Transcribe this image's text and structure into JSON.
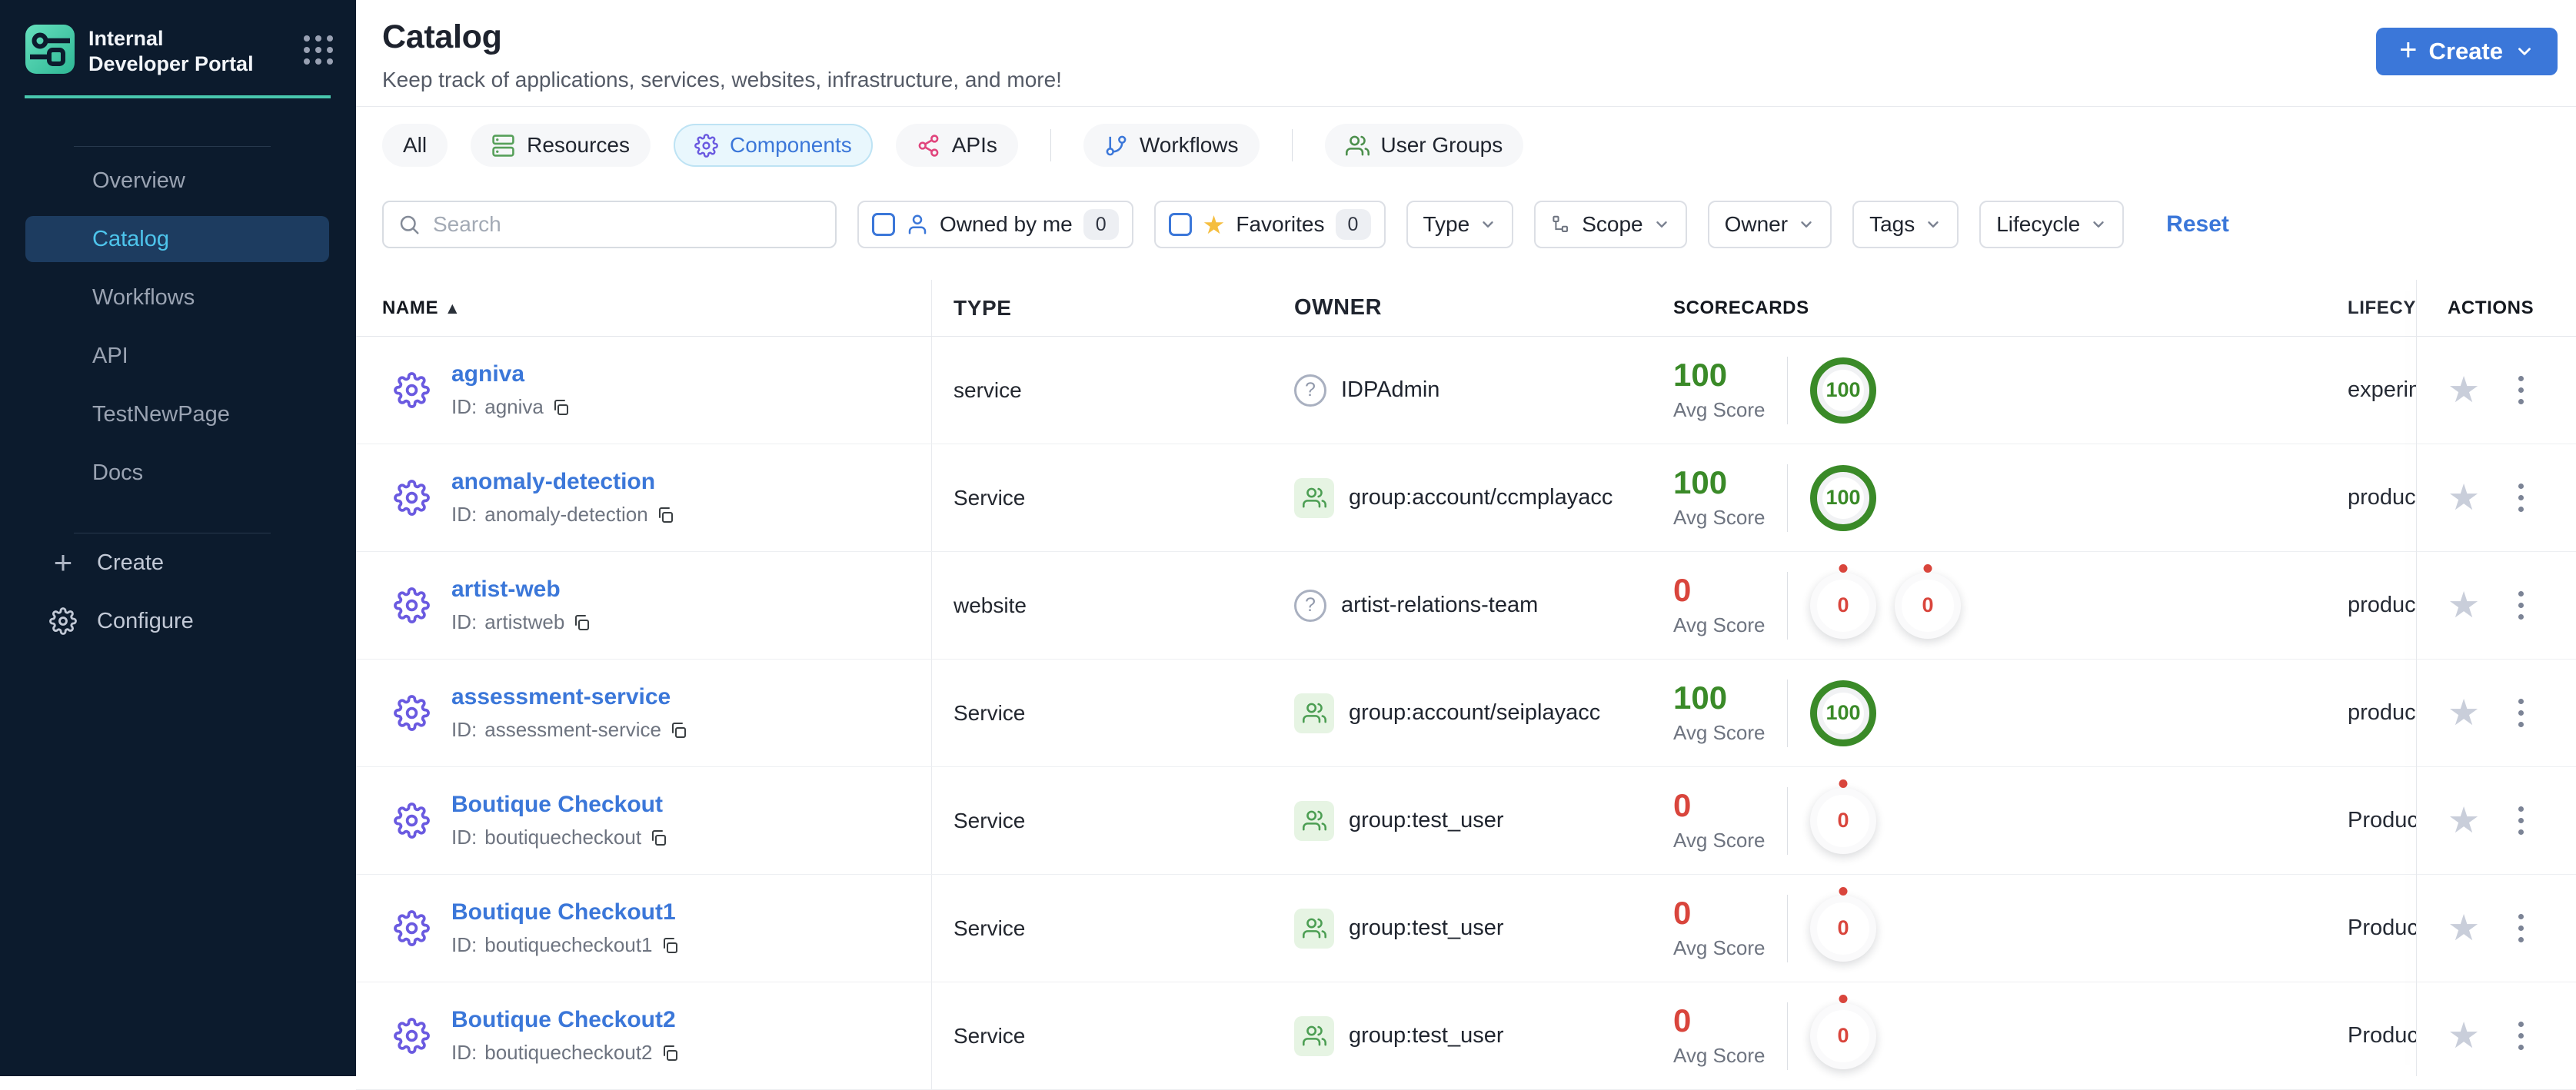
{
  "colors": {
    "accent_blue": "#3B77D9",
    "success_green": "#3A8A28",
    "error_red": "#D9453C",
    "brand_teal": "#49C7AE",
    "sidebar_bg": "#0C1B2D",
    "sidebar_active_bg": "#1D3C60",
    "sidebar_active_text": "#4EC5EC",
    "active_tab_bg": "#E9F7FD",
    "favorite_yellow": "#F5BE3F",
    "component_gear_purple": "#6A5AE0",
    "apis_pink": "#E0447C",
    "resources_green": "#57A05A"
  },
  "brand": {
    "title": "Internal Developer Portal"
  },
  "sidebar": {
    "items": [
      {
        "label": "Overview"
      },
      {
        "label": "Catalog",
        "active": true
      },
      {
        "label": "Workflows"
      },
      {
        "label": "API"
      },
      {
        "label": "TestNewPage"
      },
      {
        "label": "Docs"
      }
    ],
    "create_label": "Create",
    "configure_label": "Configure"
  },
  "page": {
    "title": "Catalog",
    "subtitle": "Keep track of applications, services, websites, infrastructure, and more!",
    "create_button": "Create"
  },
  "tabs": [
    {
      "label": "All"
    },
    {
      "label": "Resources"
    },
    {
      "label": "Components",
      "active": true
    },
    {
      "label": "APIs"
    },
    {
      "label": "Workflows"
    },
    {
      "label": "User Groups"
    }
  ],
  "filters": {
    "search_placeholder": "Search",
    "owned_by_me": {
      "label": "Owned by me",
      "count": "0"
    },
    "favorites": {
      "label": "Favorites",
      "count": "0"
    },
    "dropdowns": [
      {
        "label": "Type"
      },
      {
        "label": "Scope"
      },
      {
        "label": "Owner"
      },
      {
        "label": "Tags"
      },
      {
        "label": "Lifecycle"
      }
    ],
    "reset_label": "Reset"
  },
  "table": {
    "headers": {
      "name": "NAME",
      "type": "TYPE",
      "owner": "OWNER",
      "scorecards": "SCORECARDS",
      "lifecycle": "LIFECYCLE",
      "actions": "ACTIONS"
    },
    "id_prefix": "ID:",
    "avg_score_label": "Avg Score",
    "rows": [
      {
        "name": "agniva",
        "id": "agniva",
        "type": "service",
        "owner": {
          "kind": "unknown",
          "name": "IDPAdmin"
        },
        "scorecards": {
          "avg": 100,
          "circles": [
            100
          ]
        },
        "lifecycle": "experimental"
      },
      {
        "name": "anomaly-detection",
        "id": "anomaly-detection",
        "type": "Service",
        "owner": {
          "kind": "group",
          "name": "group:account/ccmplayacc"
        },
        "scorecards": {
          "avg": 100,
          "circles": [
            100
          ]
        },
        "lifecycle": "production"
      },
      {
        "name": "artist-web",
        "id": "artistweb",
        "type": "website",
        "owner": {
          "kind": "unknown",
          "name": "artist-relations-team"
        },
        "scorecards": {
          "avg": 0,
          "circles": [
            0,
            0
          ]
        },
        "lifecycle": "production"
      },
      {
        "name": "assessment-service",
        "id": "assessment-service",
        "type": "Service",
        "owner": {
          "kind": "group",
          "name": "group:account/seiplayacc"
        },
        "scorecards": {
          "avg": 100,
          "circles": [
            100
          ]
        },
        "lifecycle": "production"
      },
      {
        "name": "Boutique Checkout",
        "id": "boutiquecheckout",
        "type": "Service",
        "owner": {
          "kind": "group",
          "name": "group:test_user"
        },
        "scorecards": {
          "avg": 0,
          "circles": [
            0
          ]
        },
        "lifecycle": "Production"
      },
      {
        "name": "Boutique Checkout1",
        "id": "boutiquecheckout1",
        "type": "Service",
        "owner": {
          "kind": "group",
          "name": "group:test_user"
        },
        "scorecards": {
          "avg": 0,
          "circles": [
            0
          ]
        },
        "lifecycle": "Production"
      },
      {
        "name": "Boutique Checkout2",
        "id": "boutiquecheckout2",
        "type": "Service",
        "owner": {
          "kind": "group",
          "name": "group:test_user"
        },
        "scorecards": {
          "avg": 0,
          "circles": [
            0
          ]
        },
        "lifecycle": "Production"
      }
    ]
  }
}
